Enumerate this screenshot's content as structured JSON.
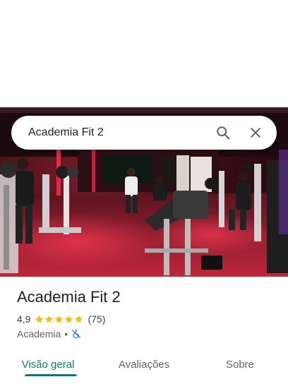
{
  "search": {
    "query": "Academia Fit 2"
  },
  "place": {
    "name": "Academia Fit 2",
    "rating": "4,9",
    "stars": 5,
    "review_count": "(75)",
    "category": "Academia",
    "separator": "•"
  },
  "tabs": [
    {
      "label": "Visão geral",
      "active": true
    },
    {
      "label": "Avaliações",
      "active": false
    },
    {
      "label": "Sobre",
      "active": false
    }
  ],
  "colors": {
    "accent": "#0b7a6f",
    "star": "#fbbc04",
    "accessibility_icon": "#1a73e8"
  }
}
